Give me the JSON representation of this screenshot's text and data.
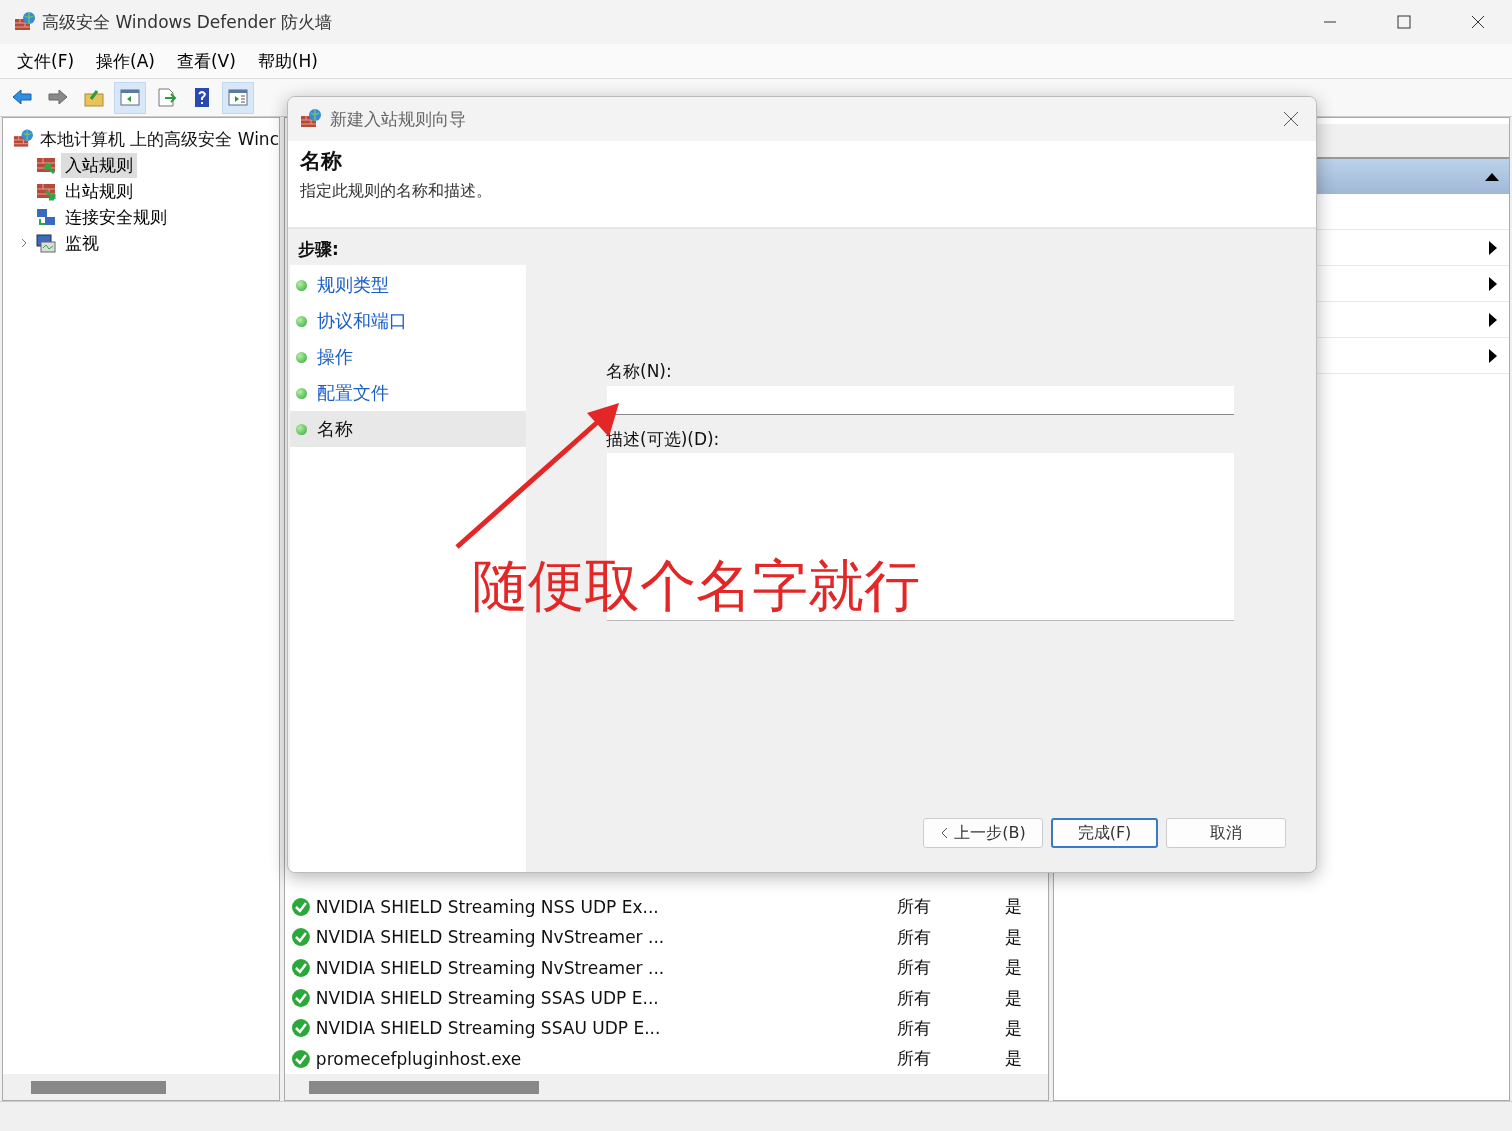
{
  "window": {
    "title": "高级安全 Windows Defender 防火墙"
  },
  "menu": [
    "文件(F)",
    "操作(A)",
    "查看(V)",
    "帮助(H)"
  ],
  "toolbar": [
    {
      "kind": "back",
      "pressed": false
    },
    {
      "kind": "forward",
      "pressed": false
    },
    {
      "kind": "up",
      "pressed": false
    },
    {
      "kind": "tree",
      "pressed": true
    },
    {
      "kind": "export",
      "pressed": false
    },
    {
      "kind": "help",
      "pressed": false
    },
    {
      "kind": "pane",
      "pressed": true
    }
  ],
  "tree": {
    "root": "本地计算机 上的高级安全 Winc",
    "children": [
      {
        "label": "入站规则",
        "kind": "inbound",
        "selected": true
      },
      {
        "label": "出站规则",
        "kind": "outbound",
        "selected": false
      },
      {
        "label": "连接安全规则",
        "kind": "connection",
        "selected": false
      },
      {
        "label": "监视",
        "kind": "monitor",
        "selected": false,
        "expanded": false
      }
    ]
  },
  "rules": [
    {
      "name": "NVIDIA SHIELD Streaming NSS UDP Ex...",
      "profile": "所有",
      "enabled": "是"
    },
    {
      "name": "NVIDIA SHIELD Streaming NvStreamer ...",
      "profile": "所有",
      "enabled": "是"
    },
    {
      "name": "NVIDIA SHIELD Streaming NvStreamer ...",
      "profile": "所有",
      "enabled": "是"
    },
    {
      "name": "NVIDIA SHIELD Streaming SSAS UDP E...",
      "profile": "所有",
      "enabled": "是"
    },
    {
      "name": "NVIDIA SHIELD Streaming SSAU UDP E...",
      "profile": "所有",
      "enabled": "是"
    },
    {
      "name": "promecefpluginhost.exe",
      "profile": "所有",
      "enabled": "是"
    }
  ],
  "dialog": {
    "title": "新建入站规则向导",
    "heading": "名称",
    "subtitle": "指定此规则的名称和描述。",
    "steps_label": "步骤:",
    "steps": [
      {
        "label": "规则类型",
        "selected": false
      },
      {
        "label": "协议和端口",
        "selected": false
      },
      {
        "label": "操作",
        "selected": false
      },
      {
        "label": "配置文件",
        "selected": false
      },
      {
        "label": "名称",
        "selected": true
      }
    ],
    "name_label": "名称(N):",
    "description_label": "描述(可选)(D):",
    "buttons": [
      {
        "label": "上一步(B)",
        "kind": "back",
        "focused": false
      },
      {
        "label": "完成(F)",
        "kind": "plain",
        "focused": true
      },
      {
        "label": "取消",
        "kind": "plain",
        "focused": false
      }
    ]
  },
  "annotation": {
    "text": "随便取个名字就行"
  }
}
